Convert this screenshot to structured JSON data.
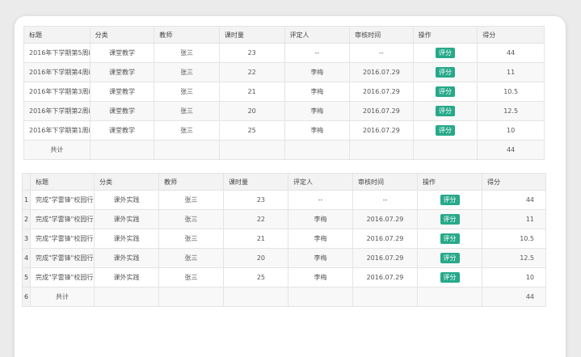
{
  "table1": {
    "headers": [
      "标题",
      "分类",
      "教师",
      "课时量",
      "评定人",
      "审核时间",
      "操作",
      "得分"
    ],
    "rows": [
      {
        "title": "2016年下学期第5周i",
        "category": "课堂教学",
        "teacher": "张三",
        "hours": "23",
        "rater": "--",
        "review_time": "--",
        "action": "评分",
        "score": "44"
      },
      {
        "title": "2016年下学期第4周i",
        "category": "课堂教学",
        "teacher": "张三",
        "hours": "22",
        "rater": "李梅",
        "review_time": "2016.07.29",
        "action": "评分",
        "score": "11"
      },
      {
        "title": "2016年下学期第3周i",
        "category": "课堂教学",
        "teacher": "张三",
        "hours": "21",
        "rater": "李梅",
        "review_time": "2016.07.29",
        "action": "评分",
        "score": "10.5"
      },
      {
        "title": "2016年下学期第2周i",
        "category": "课堂教学",
        "teacher": "张三",
        "hours": "20",
        "rater": "李梅",
        "review_time": "2016.07.29",
        "action": "评分",
        "score": "12.5"
      },
      {
        "title": "2016年下学期第1周i",
        "category": "课堂教学",
        "teacher": "张三",
        "hours": "25",
        "rater": "李梅",
        "review_time": "2016.07.29",
        "action": "评分",
        "score": "10"
      }
    ],
    "total_label": "共计",
    "total_score": "44"
  },
  "table2": {
    "headers": [
      "标题",
      "分类",
      "教师",
      "课时量",
      "评定人",
      "审核时间",
      "操作",
      "得分"
    ],
    "rows": [
      {
        "index": "1",
        "title": "完成\"学雷锋\"校园行动",
        "category": "课外实践",
        "teacher": "张三",
        "hours": "23",
        "rater": "--",
        "review_time": "--",
        "action": "评分",
        "score": "44"
      },
      {
        "index": "2",
        "title": "完成\"学雷锋\"校园行动",
        "category": "课外实践",
        "teacher": "张三",
        "hours": "22",
        "rater": "李梅",
        "review_time": "2016.07.29",
        "action": "评分",
        "score": "11"
      },
      {
        "index": "3",
        "title": "完成\"学雷锋\"校园行动",
        "category": "课外实践",
        "teacher": "张三",
        "hours": "21",
        "rater": "李梅",
        "review_time": "2016.07.29",
        "action": "评分",
        "score": "10.5"
      },
      {
        "index": "4",
        "title": "完成\"学雷锋\"校园行动",
        "category": "课外实践",
        "teacher": "张三",
        "hours": "20",
        "rater": "李梅",
        "review_time": "2016.07.29",
        "action": "评分",
        "score": "12.5"
      },
      {
        "index": "5",
        "title": "完成\"学雷锋\"校园行动",
        "category": "课外实践",
        "teacher": "张三",
        "hours": "25",
        "rater": "李梅",
        "review_time": "2016.07.29",
        "action": "评分",
        "score": "10"
      }
    ],
    "total_index": "6",
    "total_label": "共计",
    "total_score": "44"
  },
  "colors": {
    "accent": "#27a98a",
    "header_bg": "#f3f3f3",
    "border": "#e4e4e4"
  }
}
